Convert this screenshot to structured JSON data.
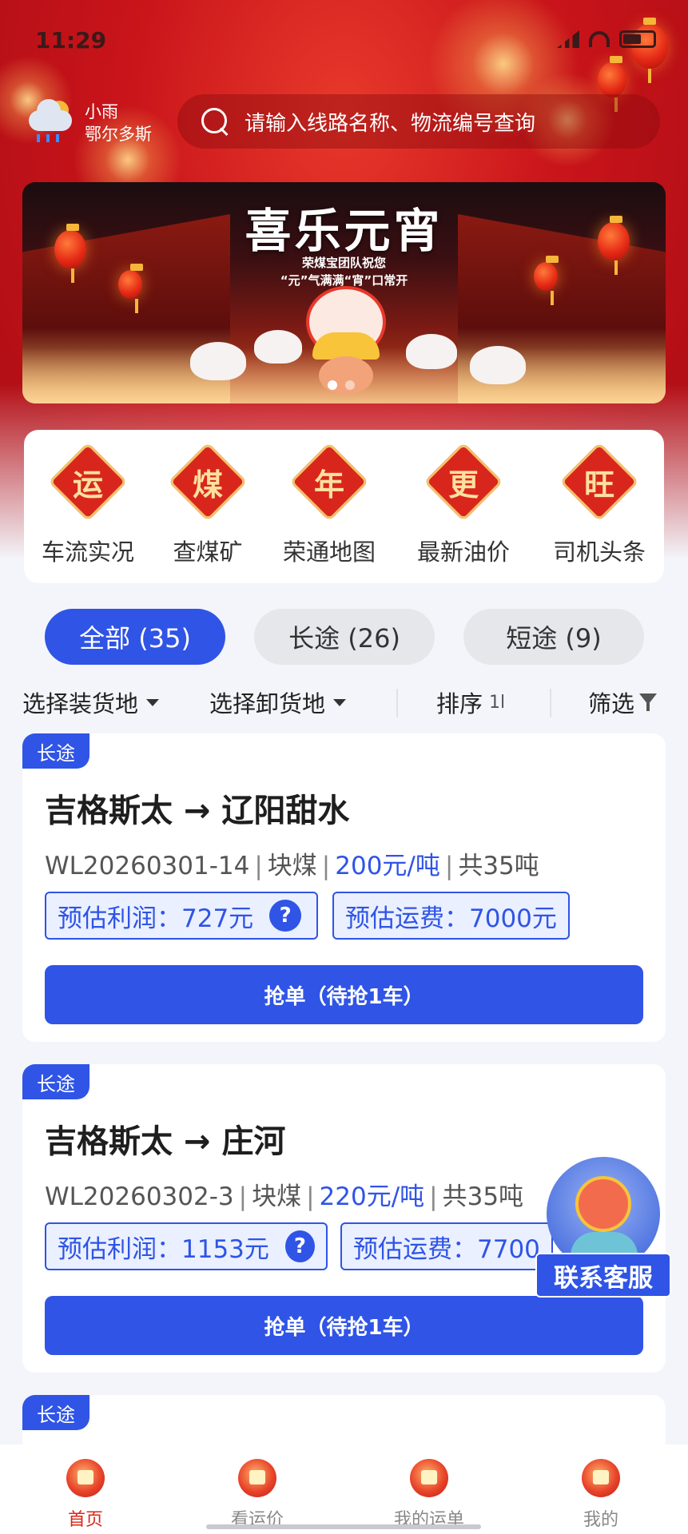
{
  "status_bar": {
    "time": "11:29"
  },
  "weather": {
    "condition": "小雨",
    "city": "鄂尔多斯"
  },
  "search": {
    "placeholder": "请输入线路名称、物流编号查询"
  },
  "banner": {
    "title": "喜乐元宵",
    "subtitle_line1": "荣煤宝团队祝您",
    "subtitle_line2": "“元”气满满“宵”口常开",
    "slide_count": 2,
    "active_slide": 1
  },
  "quick_menu": [
    {
      "char": "运",
      "label": "车流实况"
    },
    {
      "char": "煤",
      "label": "查煤矿"
    },
    {
      "char": "年",
      "label": "荣通地图"
    },
    {
      "char": "更",
      "label": "最新油价"
    },
    {
      "char": "旺",
      "label": "司机头条"
    }
  ],
  "tabs": [
    {
      "label": "全部 (35)",
      "active": true
    },
    {
      "label": "长途 (26)",
      "active": false
    },
    {
      "label": "短途 (9)",
      "active": false
    }
  ],
  "filters": {
    "load_place": "选择装货地",
    "unload_place": "选择卸货地",
    "sort": "排序",
    "sort_icon": "1l",
    "filter": "筛选"
  },
  "orders": [
    {
      "tag": "长途",
      "route": "吉格斯太 → 辽阳甜水",
      "waybill": "WL20260301-14",
      "cargo": "块煤",
      "price": "200元/吨",
      "total": "共35吨",
      "profit": "预估利润：727元",
      "freight": "预估运费：7000元",
      "button": "抢单（待抢1车）"
    },
    {
      "tag": "长途",
      "route": "吉格斯太 → 庄河",
      "waybill": "WL20260302-3",
      "cargo": "块煤",
      "price": "220元/吨",
      "total": "共35吨",
      "profit": "预估利润：1153元",
      "freight": "预估运费：7700",
      "button": "抢单（待抢1车）"
    },
    {
      "tag": "长途"
    }
  ],
  "customer_service": {
    "label": "联系客服"
  },
  "bottom_nav": [
    {
      "label": "首页",
      "active": true
    },
    {
      "label": "看运价",
      "active": false
    },
    {
      "label": "我的运单",
      "active": false
    },
    {
      "label": "我的",
      "active": false
    }
  ],
  "colors": {
    "primary": "#2f54e6",
    "festive_red": "#d9261c",
    "background": "#f3f5fa"
  }
}
